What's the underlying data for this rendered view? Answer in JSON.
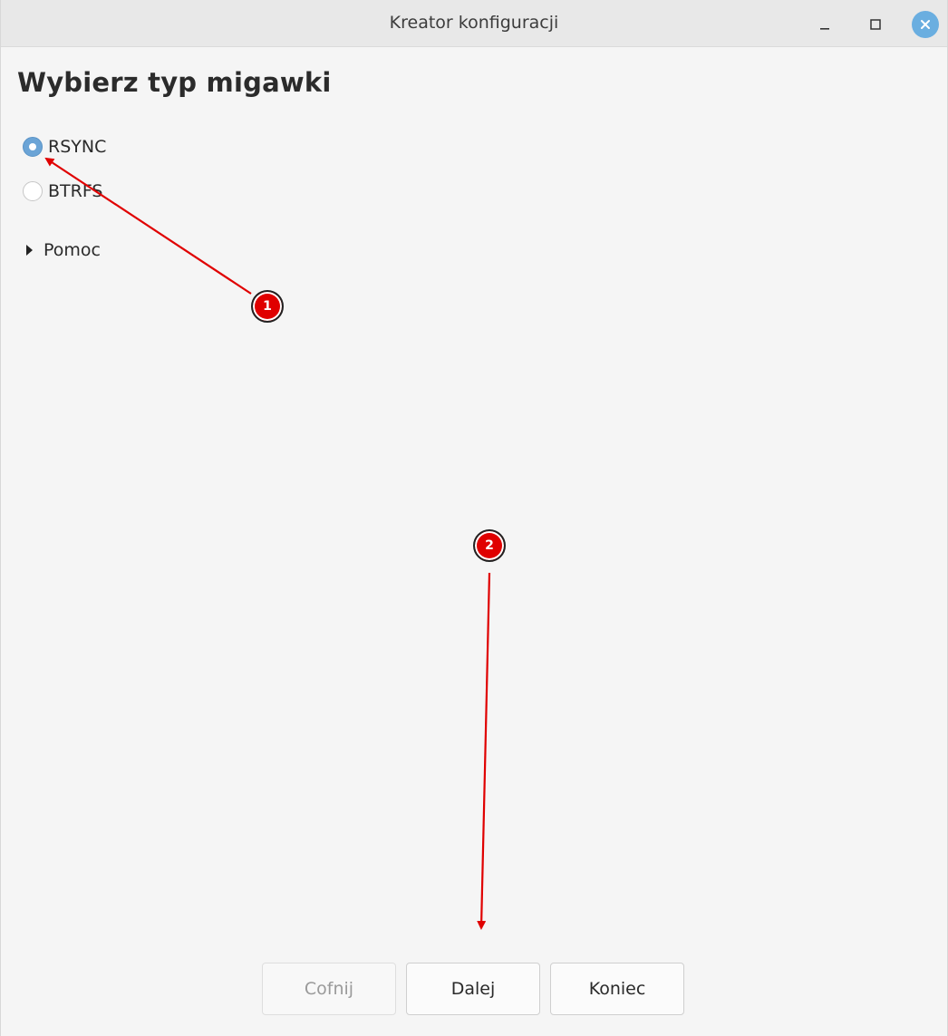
{
  "window": {
    "title": "Kreator konfiguracji"
  },
  "page": {
    "heading": "Wybierz typ migawki"
  },
  "options": [
    {
      "label": "RSYNC",
      "selected": true
    },
    {
      "label": "BTRFS",
      "selected": false
    }
  ],
  "help": {
    "label": "Pomoc",
    "expanded": false
  },
  "buttons": {
    "back": "Cofnij",
    "next": "Dalej",
    "finish": "Koniec"
  },
  "annotations": {
    "badge1": "1",
    "badge2": "2",
    "color": "#e00000"
  },
  "colors": {
    "accent": "#6ba4d6",
    "close_button": "#6aaee0",
    "background": "#f5f5f5"
  },
  "icons": {
    "minimize": "minimize-icon",
    "maximize": "maximize-icon",
    "close": "close-icon",
    "expander": "triangle-right-icon"
  }
}
